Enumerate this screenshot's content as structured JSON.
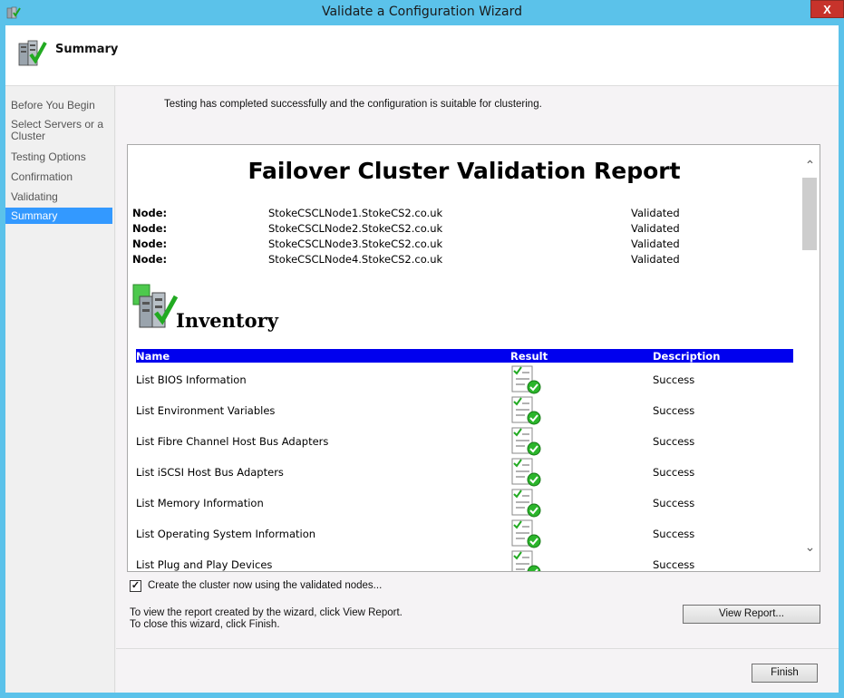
{
  "window": {
    "title": "Validate a Configuration Wizard",
    "close_label": "X"
  },
  "header": {
    "title": "Summary",
    "icon": "cluster-validate-icon"
  },
  "nav": {
    "items": [
      {
        "label": "Before You Begin"
      },
      {
        "label": "Select Servers or a Cluster"
      },
      {
        "label": "Testing Options"
      },
      {
        "label": "Confirmation"
      },
      {
        "label": "Validating"
      },
      {
        "label": "Summary",
        "active": true
      }
    ]
  },
  "main": {
    "status_message": "Testing has completed successfully and the configuration is suitable for clustering.",
    "report": {
      "title": "Failover Cluster Validation Report",
      "nodes": [
        {
          "label": "Node:",
          "name": "StokeCSCLNode1.StokeCS2.co.uk",
          "status": "Validated"
        },
        {
          "label": "Node:",
          "name": "StokeCSCLNode2.StokeCS2.co.uk",
          "status": "Validated"
        },
        {
          "label": "Node:",
          "name": "StokeCSCLNode3.StokeCS2.co.uk",
          "status": "Validated"
        },
        {
          "label": "Node:",
          "name": "StokeCSCLNode4.StokeCS2.co.uk",
          "status": "Validated"
        }
      ],
      "section_title": "Inventory",
      "table_headers": {
        "name": "Name",
        "result": "Result",
        "description": "Description"
      },
      "rows": [
        {
          "name": "List BIOS Information",
          "description": "Success"
        },
        {
          "name": "List Environment Variables",
          "description": "Success"
        },
        {
          "name": "List Fibre Channel Host Bus Adapters",
          "description": "Success"
        },
        {
          "name": "List iSCSI Host Bus Adapters",
          "description": "Success"
        },
        {
          "name": "List Memory Information",
          "description": "Success"
        },
        {
          "name": "List Operating System Information",
          "description": "Success"
        },
        {
          "name": "List Plug and Play Devices",
          "description": "Success"
        }
      ]
    },
    "create_cluster_checkbox": {
      "label": "Create the cluster now using the validated nodes...",
      "checked": true
    },
    "info_lines": [
      "To view the report created by the wizard, click View Report.",
      "To close this wizard, click Finish."
    ],
    "view_report_label": "View Report...",
    "finish_label": "Finish"
  },
  "colors": {
    "titlebar": "#5bc2ea",
    "nav_active": "#3399ff",
    "table_header": "#0000ee",
    "close": "#c7332b"
  }
}
